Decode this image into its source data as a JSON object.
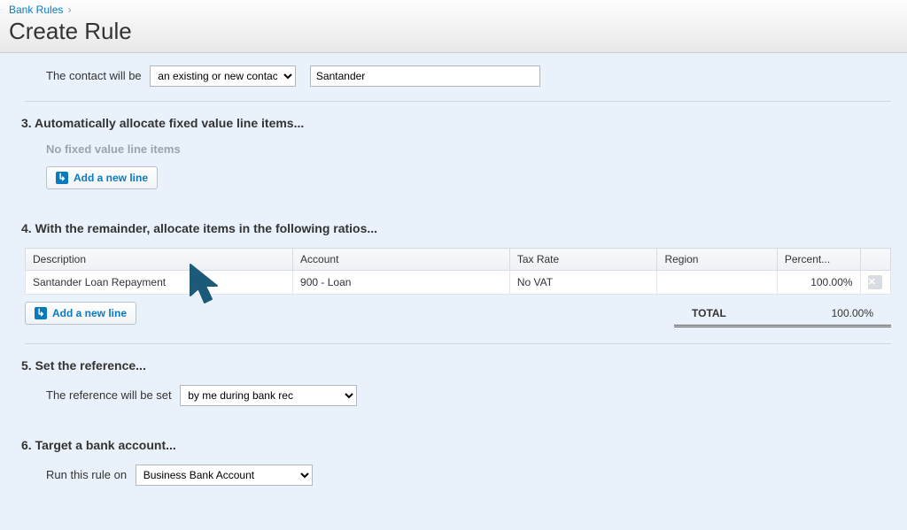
{
  "breadcrumb": {
    "parent": "Bank Rules",
    "sep": "›"
  },
  "page_title": "Create Rule",
  "contact": {
    "label": "The contact will be",
    "mode": "an existing or new contact",
    "value": "Santander"
  },
  "section3": {
    "heading": "3.  Automatically allocate fixed value line items...",
    "empty": "No fixed value line items",
    "add": "Add a new line"
  },
  "section4": {
    "heading": "4.  With the remainder, allocate items in the following ratios...",
    "cols": {
      "desc": "Description",
      "account": "Account",
      "tax": "Tax Rate",
      "region": "Region",
      "percent": "Percent..."
    },
    "rows": [
      {
        "desc": "Santander Loan Repayment",
        "account": "900 - Loan",
        "tax": "No VAT",
        "region": "",
        "percent": "100.00%"
      }
    ],
    "add": "Add a new line",
    "total_label": "TOTAL",
    "total_value": "100.00%"
  },
  "section5": {
    "heading": "5.  Set the reference...",
    "label": "The reference will be set",
    "value": "by me during bank rec"
  },
  "section6": {
    "heading": "6.  Target a bank account...",
    "label": "Run this rule on",
    "value": "Business Bank Account"
  }
}
